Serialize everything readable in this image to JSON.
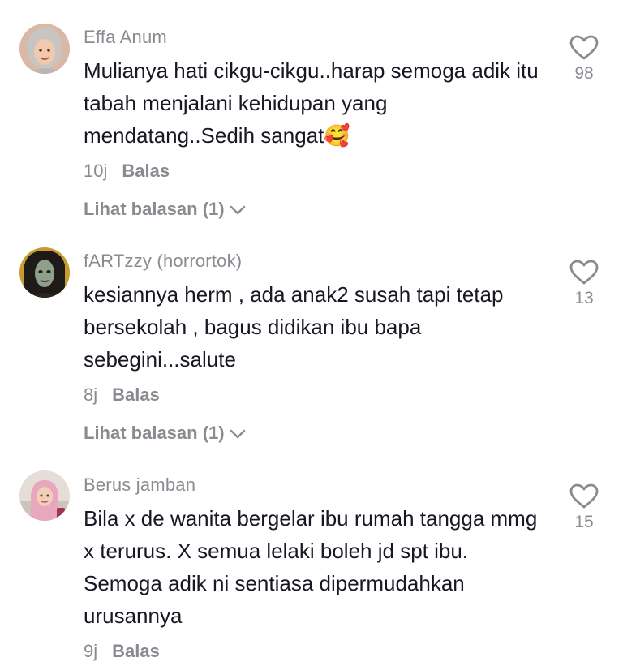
{
  "comments": [
    {
      "username": "Effa Anum",
      "text": "Mulianya hati cikgu-cikgu..harap semoga adik itu tabah menjalani kehidupan yang mendatang..Sedih sangat",
      "emoji": "🥰",
      "time": "10j",
      "reply_label": "Balas",
      "view_replies_label": "Lihat balasan (1)",
      "likes": "98"
    },
    {
      "username": "fARTzzy (horrortok)",
      "text": "kesiannya herm , ada anak2 susah tapi tetap bersekolah , bagus didikan ibu bapa sebegini...salute",
      "time": "8j",
      "reply_label": "Balas",
      "view_replies_label": "Lihat balasan (1)",
      "likes": "13"
    },
    {
      "username": "Berus jamban",
      "text": "Bila x de wanita bergelar ibu rumah tangga mmg x terurus. X semua lelaki boleh jd spt ibu. Semoga adik ni sentiasa dipermudahkan urusannya",
      "time": "9j",
      "reply_label": "Balas",
      "likes": "15"
    }
  ],
  "icons": {
    "like": "heart-outline-icon",
    "expand": "chevron-down-icon"
  },
  "colors": {
    "text": "#161823",
    "secondary": "#8a8b91",
    "background": "#ffffff"
  }
}
